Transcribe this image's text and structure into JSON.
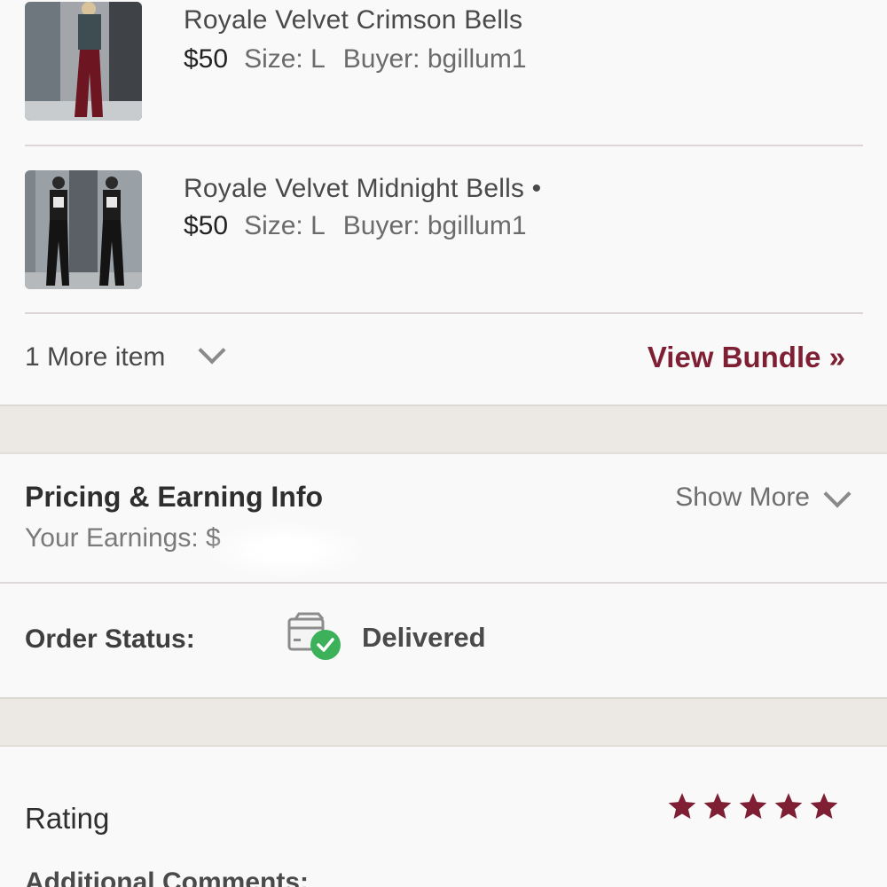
{
  "items": [
    {
      "title": "Royale Velvet Crimson Bells",
      "price": "$50",
      "size": "Size: L",
      "buyer": "Buyer: bgillum1"
    },
    {
      "title": "Royale Velvet Midnight Bells •",
      "price": "$50",
      "size": "Size: L",
      "buyer": "Buyer: bgillum1"
    }
  ],
  "bundle": {
    "more_label": "1 More item",
    "view_bundle_label": "View Bundle »"
  },
  "pricing": {
    "title": "Pricing & Earning Info",
    "earnings_label": "Your Earnings: $",
    "show_more_label": "Show More"
  },
  "order": {
    "status_label": "Order Status:",
    "status_value": "Delivered"
  },
  "rating": {
    "title": "Rating",
    "stars": 5,
    "max_stars": 5,
    "star_color": "#7f1f34",
    "comments_label": "Additional Comments:"
  },
  "colors": {
    "accent": "#7f1f34",
    "delivered_check": "#3cb15a"
  }
}
